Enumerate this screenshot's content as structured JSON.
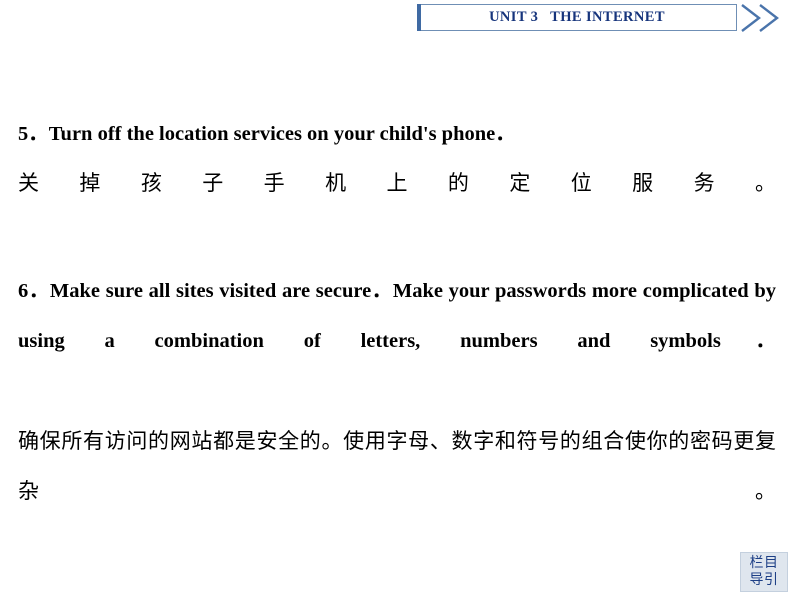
{
  "header": {
    "unit_title": "UNIT 3   THE INTERNET",
    "chevron_icon": "double-chevron-right-icon",
    "border_color": "#6f8fb5",
    "title_color": "#16347c",
    "accent_bar_color": "#3f6aa3"
  },
  "content": {
    "items": [
      {
        "number": "5",
        "english": "5．Turn off the location services on your child's phone．",
        "chinese": "关掉孩子手机上的定位服务。"
      },
      {
        "number": "6",
        "english": "6．Make sure all sites visited are secure．Make your passwords more complicated by using a combination of letters, numbers and symbols．",
        "chinese": "确保所有访问的网站都是安全的。使用字母、数字和符号的组合使你的密码更复杂。"
      }
    ]
  },
  "corner_badge": {
    "line1": "栏目",
    "line2": "导引",
    "text_color": "#1d3f86",
    "bg_color": "#dfe6ee"
  }
}
